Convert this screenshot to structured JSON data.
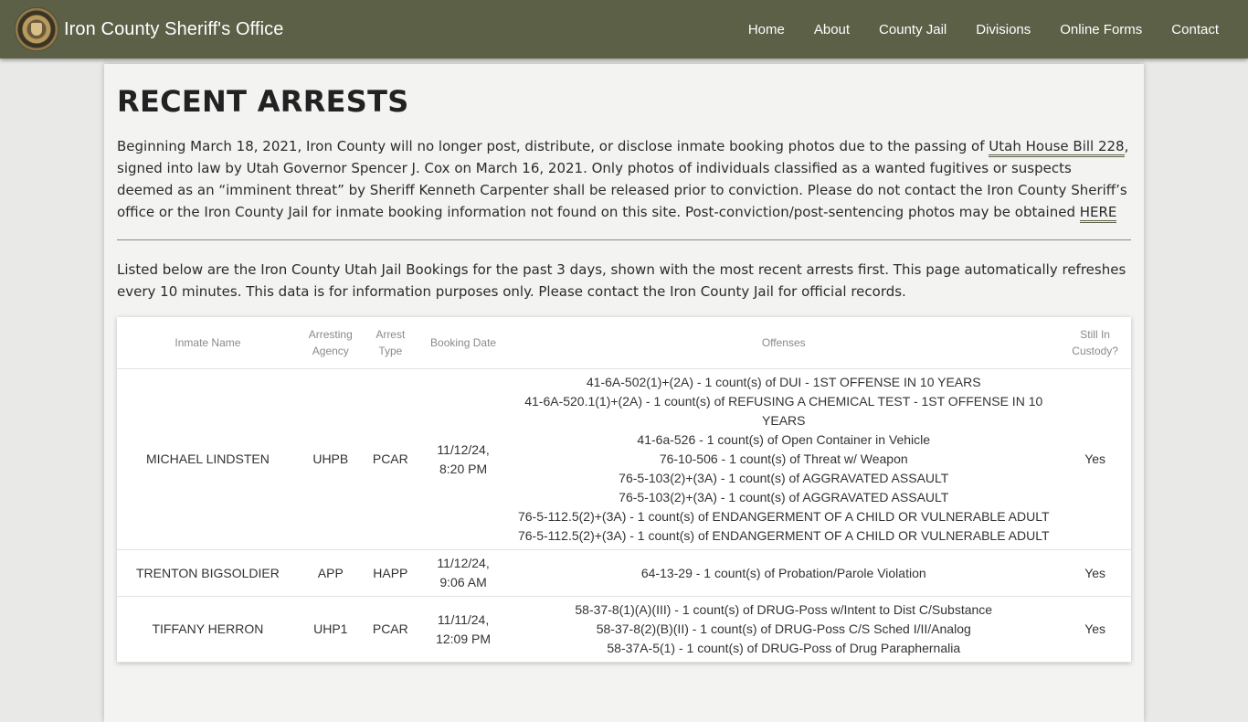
{
  "header": {
    "site_title": "Iron County Sheriff's Office",
    "logo_icon": "sheriff-badge-icon",
    "nav": [
      {
        "label": "Home"
      },
      {
        "label": "About"
      },
      {
        "label": "County Jail"
      },
      {
        "label": "Divisions"
      },
      {
        "label": "Online Forms"
      },
      {
        "label": "Contact"
      }
    ],
    "colors": {
      "navbar": "#5b6047",
      "page_bg": "#e9e9e7"
    }
  },
  "main": {
    "title": "RECENT ARRESTS",
    "notice": {
      "part1": "Beginning March 18, 2021, Iron County will no longer post, distribute, or disclose inmate booking photos due to the passing of ",
      "link1": "Utah House Bill 228",
      "part2": ", signed into law by Utah Governor Spencer J. Cox on March 16, 2021. Only photos of individuals classified as a wanted fugitives or suspects deemed as an “imminent threat” by Sheriff Kenneth Carpenter shall be released prior to conviction. Please do not contact the Iron County Sheriff’s office or the Iron County Jail for inmate booking information not found on this site. Post-conviction/post-sentencing photos may be obtained ",
      "link2": "HERE"
    },
    "intro": "Listed below are the Iron County Utah Jail Bookings for the past 3 days, shown with the most recent arrests first. This page automatically refreshes every 10 minutes. This data is for information purposes only. Please contact the Iron County Jail for official records.",
    "table": {
      "headers": {
        "name": "Inmate Name",
        "agency": "Arresting Agency",
        "type": "Arrest Type",
        "date": "Booking Date",
        "offenses": "Offenses",
        "custody": "Still In Custody?"
      },
      "rows": [
        {
          "name": "MICHAEL LINDSTEN",
          "agency": "UHPB",
          "type": "PCAR",
          "date": "11/12/24, 8:20 PM",
          "offenses": [
            "41-6A-502(1)+(2A) - 1 count(s) of DUI - 1ST OFFENSE IN 10 YEARS",
            "41-6A-520.1(1)+(2A) - 1 count(s) of REFUSING A CHEMICAL TEST - 1ST OFFENSE IN 10 YEARS",
            "41-6a-526 - 1 count(s) of Open Container in Vehicle",
            "76-10-506 - 1 count(s) of Threat w/ Weapon",
            "76-5-103(2)+(3A) - 1 count(s) of AGGRAVATED ASSAULT",
            "76-5-103(2)+(3A) - 1 count(s) of AGGRAVATED ASSAULT",
            "76-5-112.5(2)+(3A) - 1 count(s) of ENDANGERMENT OF A CHILD OR VULNERABLE ADULT",
            "76-5-112.5(2)+(3A) - 1 count(s) of ENDANGERMENT OF A CHILD OR VULNERABLE ADULT"
          ],
          "custody": "Yes"
        },
        {
          "name": "TRENTON BIGSOLDIER",
          "agency": "APP",
          "type": "HAPP",
          "date": "11/12/24, 9:06 AM",
          "offenses": [
            "64-13-29 - 1 count(s) of Probation/Parole Violation"
          ],
          "custody": "Yes"
        },
        {
          "name": "TIFFANY HERRON",
          "agency": "UHP1",
          "type": "PCAR",
          "date": "11/11/24, 12:09 PM",
          "offenses": [
            "58-37-8(1)(A)(III) - 1 count(s) of DRUG-Poss w/Intent to Dist C/Substance",
            "58-37-8(2)(B)(II) - 1 count(s) of DRUG-Poss C/S Sched I/II/Analog",
            "58-37A-5(1) - 1 count(s) of DRUG-Poss of Drug Paraphernalia"
          ],
          "custody": "Yes"
        }
      ]
    }
  }
}
